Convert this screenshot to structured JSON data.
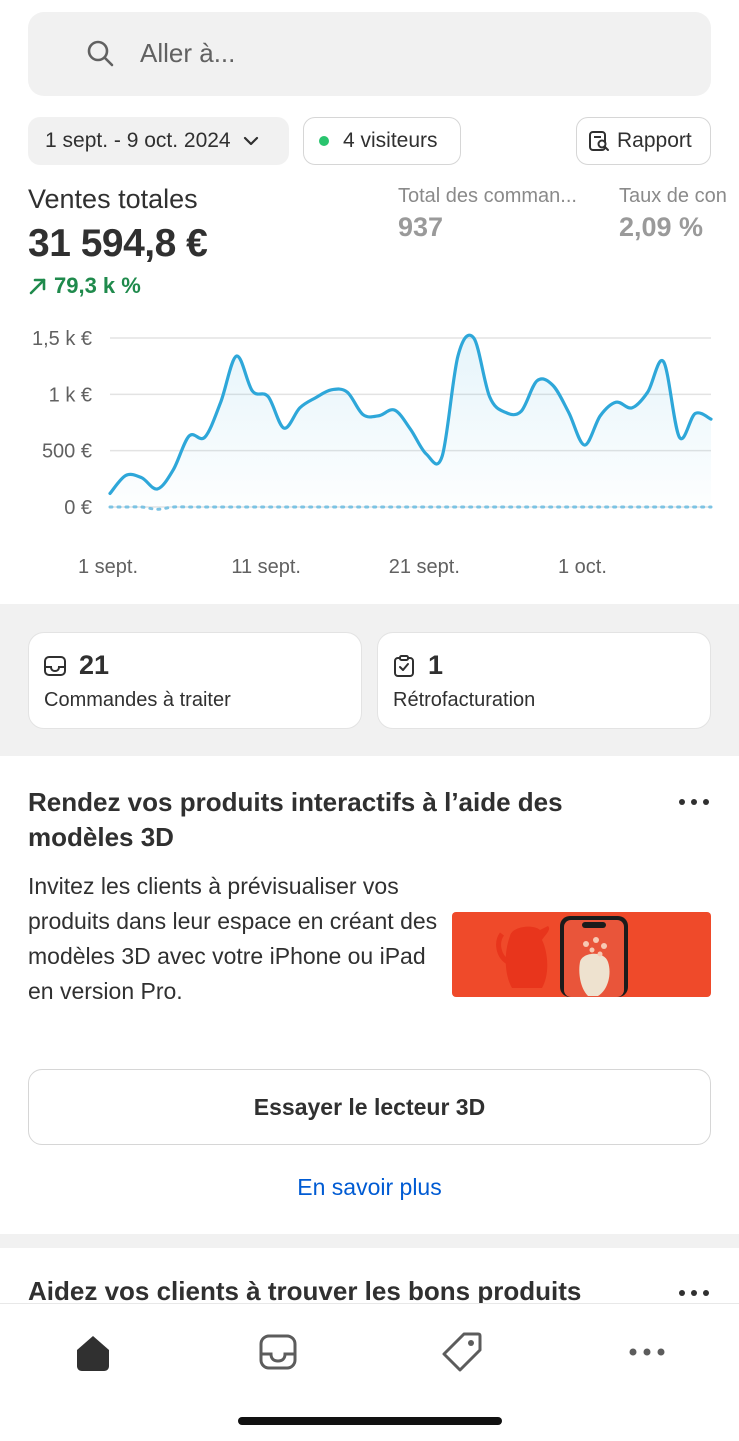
{
  "search": {
    "placeholder": "Aller à..."
  },
  "filters": {
    "date_range": "1 sept. - 9 oct. 2024",
    "visitors": "4 visiteurs",
    "report": "Rapport"
  },
  "metrics": {
    "main_label": "Ventes totales",
    "main_value": "31 594,8 €",
    "main_change": "79,3 k %",
    "orders_label": "Total des comman...",
    "orders_value": "937",
    "conversion_label": "Taux de con",
    "conversion_value": "2,09 %"
  },
  "chart_data": {
    "type": "line",
    "y_ticks": [
      "1,5 k €",
      "1 k €",
      "500 €",
      "0 €"
    ],
    "x_ticks": [
      "1 sept.",
      "11 sept.",
      "21 sept.",
      "1 oct."
    ],
    "ylim": [
      0,
      1500
    ],
    "grid": true,
    "x": [
      "1 sept.",
      "2 sept.",
      "3 sept.",
      "4 sept.",
      "5 sept.",
      "6 sept.",
      "7 sept.",
      "8 sept.",
      "9 sept.",
      "10 sept.",
      "11 sept.",
      "12 sept.",
      "13 sept.",
      "14 sept.",
      "15 sept.",
      "16 sept.",
      "17 sept.",
      "18 sept.",
      "19 sept.",
      "20 sept.",
      "21 sept.",
      "22 sept.",
      "23 sept.",
      "24 sept.",
      "25 sept.",
      "26 sept.",
      "27 sept.",
      "28 sept.",
      "29 sept.",
      "30 sept.",
      "1 oct.",
      "2 oct.",
      "3 oct.",
      "4 oct.",
      "5 oct.",
      "6 oct.",
      "7 oct.",
      "8 oct.",
      "9 oct."
    ],
    "series": [
      {
        "values": [
          120,
          280,
          260,
          160,
          330,
          630,
          620,
          930,
          1340,
          1030,
          980,
          700,
          880,
          970,
          1040,
          1020,
          820,
          810,
          860,
          690,
          470,
          450,
          1340,
          1500,
          980,
          840,
          850,
          1120,
          1080,
          840,
          550,
          810,
          930,
          880,
          1020,
          1290,
          620,
          830,
          780
        ],
        "color": "#2ea7d9"
      },
      {
        "values": [
          0,
          0,
          0,
          -20,
          0,
          0,
          0,
          0,
          0,
          0,
          0,
          0,
          0,
          0,
          0,
          0,
          0,
          0,
          0,
          0,
          0,
          0,
          0,
          0,
          0,
          0,
          0,
          0,
          0,
          0,
          0,
          0,
          0,
          0,
          0,
          0,
          0,
          0,
          0
        ],
        "color": "#7cc3e3",
        "style": "dotted"
      }
    ]
  },
  "tasks": [
    {
      "count": "21",
      "label": "Commandes à traiter",
      "icon": "inbox-icon"
    },
    {
      "count": "1",
      "label": "Rétrofacturation",
      "icon": "clipboard-check-icon"
    }
  ],
  "promo": {
    "title": "Rendez vos produits interactifs à l’aide des modèles 3D",
    "body": "Invitez les clients à prévisualiser vos produits dans leur espace en créant des modèles 3D avec votre iPhone ou iPad en version Pro.",
    "button": "Essayer le lecteur 3D",
    "link": "En savoir plus"
  },
  "promo2": {
    "title": "Aidez vos clients à trouver les bons produits"
  },
  "tabbar": [
    "home-icon",
    "inbox-icon",
    "tag-icon",
    "more-icon"
  ],
  "colors": {
    "accent_link": "#005bd3",
    "positive": "#1f8a4c",
    "line": "#2ea7d9"
  }
}
